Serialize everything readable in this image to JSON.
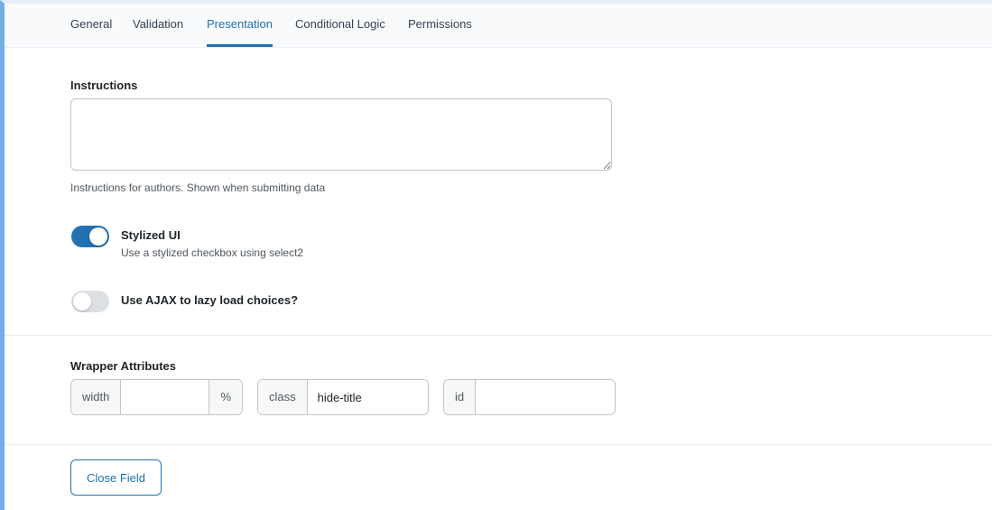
{
  "tabs": [
    {
      "label": "General",
      "active": false
    },
    {
      "label": "Validation",
      "active": false
    },
    {
      "label": "Presentation",
      "active": true
    },
    {
      "label": "Conditional Logic",
      "active": false
    },
    {
      "label": "Permissions",
      "active": false
    }
  ],
  "instructions": {
    "label": "Instructions",
    "value": "",
    "description": "Instructions for authors. Shown when submitting data"
  },
  "stylized_ui": {
    "title": "Stylized UI",
    "description": "Use a stylized checkbox using select2",
    "enabled": true
  },
  "ajax_lazy_load": {
    "title": "Use AJAX to lazy load choices?",
    "enabled": false
  },
  "wrapper_attributes": {
    "label": "Wrapper Attributes",
    "width": {
      "prefix": "width",
      "value": "",
      "suffix": "%"
    },
    "class": {
      "prefix": "class",
      "value": "hide-title"
    },
    "id": {
      "prefix": "id",
      "value": ""
    }
  },
  "close_button_label": "Close Field",
  "colors": {
    "accent": "#2271b1",
    "left_border": "#72aee6",
    "toggle_off": "#dcdfe3"
  }
}
